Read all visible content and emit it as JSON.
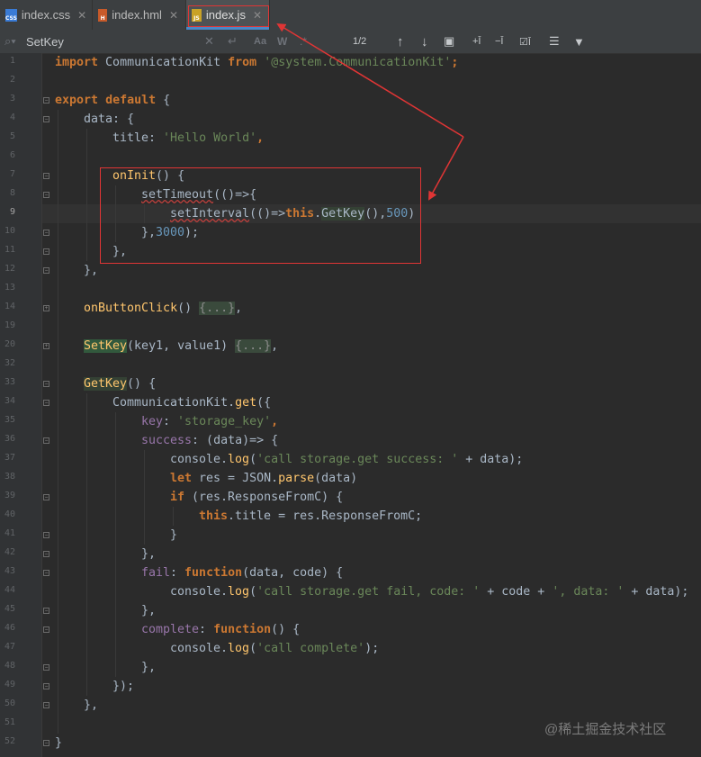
{
  "tabs": [
    {
      "label": "index.css",
      "icon": "css-file-icon",
      "icon_text": "CSS",
      "color": "#3a7bd5"
    },
    {
      "label": "index.hml",
      "icon": "hml-file-icon",
      "icon_text": "H",
      "color": "#c75a2a"
    },
    {
      "label": "index.js",
      "icon": "js-file-icon",
      "icon_text": "JS",
      "color": "#c9a227"
    }
  ],
  "search": {
    "query": "SetKey",
    "match_count": "1/2",
    "option_match_case": "Aa",
    "option_words": "W"
  },
  "gutter": {
    "line_numbers": [
      "1",
      "2",
      "3",
      "4",
      "5",
      "6",
      "7",
      "8",
      "9",
      "10",
      "11",
      "12",
      "13",
      "14",
      "19",
      "20",
      "32",
      "33",
      "34",
      "35",
      "36",
      "37",
      "38",
      "39",
      "40",
      "41",
      "42",
      "43",
      "44",
      "45",
      "46",
      "47",
      "48",
      "49",
      "50",
      "51",
      "52"
    ],
    "current_line": "9"
  },
  "code": {
    "l1": [
      "import",
      " CommunicationKit ",
      "from",
      " ",
      "'@system.CommunicationKit'",
      ";"
    ],
    "l3": [
      "export",
      " ",
      "default",
      " {"
    ],
    "l4": "data: {",
    "l5": [
      "title",
      ": ",
      "'Hello World'",
      ","
    ],
    "l7": [
      "onInit",
      "() {"
    ],
    "l8": [
      "setTimeout",
      "(()=>{"
    ],
    "l9": [
      "setInterval",
      "(()=>",
      "this",
      ".",
      "GetKey",
      "(),",
      "500",
      ")"
    ],
    "l10": [
      "},",
      "3000",
      ");"
    ],
    "l11": "},",
    "l12": "},",
    "l14": [
      "onButtonClick",
      "() ",
      "{...}",
      ","
    ],
    "l19": [
      "SetKey",
      "(key1, value1) ",
      "{...}",
      ","
    ],
    "l33": [
      "GetKey",
      "() {"
    ],
    "l34": [
      "CommunicationKit.",
      "get",
      "({"
    ],
    "l35": [
      "key",
      ": ",
      "'storage_key'",
      ","
    ],
    "l36": [
      "success",
      ": (data)=> {"
    ],
    "l37": [
      "console.",
      "log",
      "(",
      "'call storage.get success: '",
      " + data);"
    ],
    "l38": [
      "let",
      " res = JSON.",
      "parse",
      "(data)"
    ],
    "l39": [
      "if",
      " (res.ResponseFromC) {"
    ],
    "l40": [
      "this",
      ".title = res.ResponseFromC;"
    ],
    "l41": "}",
    "l42": "},",
    "l43": [
      "fail",
      ": ",
      "function",
      "(data, code) {"
    ],
    "l44": [
      "console.",
      "log",
      "(",
      "'call storage.get fail, code: '",
      " + code + ",
      "', data: '",
      " + data);"
    ],
    "l45": "},",
    "l46": [
      "complete",
      ": ",
      "function",
      "() {"
    ],
    "l47": [
      "console.",
      "log",
      "(",
      "'call complete'",
      ");"
    ],
    "l48": "},",
    "l49": "});",
    "l50": "},",
    "l52": "}"
  },
  "watermark": "@稀土掘金技术社区",
  "colors": {
    "background": "#2b2b2b",
    "keyword": "#cc7832",
    "string": "#6a8759",
    "function": "#ffc66d",
    "property": "#9876aa",
    "number": "#6897bb",
    "annotation_red": "#e03535"
  }
}
